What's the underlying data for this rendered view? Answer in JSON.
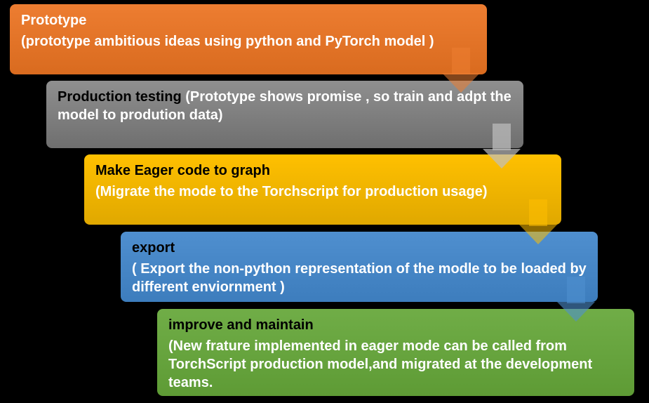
{
  "steps": [
    {
      "title": "Prototype",
      "desc": "(prototype ambitious ideas using python and PyTorch model  )",
      "color": "#ED7D31"
    },
    {
      "title": "Production testing",
      "desc": "(Prototype shows promise , so train and adpt the model to prodution data)",
      "color": "#808080"
    },
    {
      "title": "Make Eager code to graph",
      "desc": "(Migrate the mode to the Torchscript for production usage)",
      "color": "#FFC000"
    },
    {
      "title": "export",
      "desc": " ( Export the non-python representation of the modle to be loaded by different enviornment )",
      "color": "#5B9BD5"
    },
    {
      "title": "improve and maintain",
      "desc": "(New frature implemented in eager mode can be called from TorchScript production model,and migrated at the development teams.",
      "color": "#70AD47"
    }
  ]
}
